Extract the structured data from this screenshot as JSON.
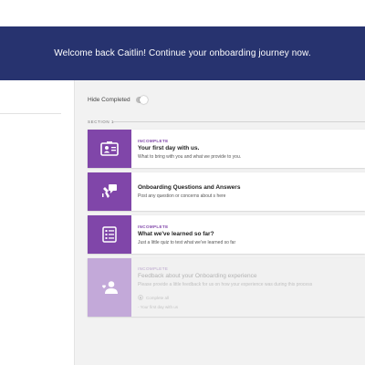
{
  "banner": {
    "text": "Welcome back Caitlin! Continue your onboarding journey now."
  },
  "controls": {
    "hide_completed_label": "Hide Completed"
  },
  "section": {
    "label": "SECTION 1"
  },
  "cards": [
    {
      "status": "INCOMPLETE",
      "title": "Your first day with us.",
      "description": "What to bring with you and what we provide to you.",
      "icon": "id-card-icon"
    },
    {
      "status": "",
      "title": "Onboarding Questions and Answers",
      "description": "Post any question or concerns about s here",
      "icon": "qa-icon"
    },
    {
      "status": "INCOMPLETE",
      "title": "What we've learned so far?",
      "description": "Just a little quiz to test what we've learned so far",
      "icon": "quiz-list-icon"
    },
    {
      "status": "INCOMPLETE",
      "title": "Feedback about your Onboarding experience",
      "description": "Please provide a little feedback for us on how your experience was during this process",
      "icon": "feedback-person-icon",
      "requirement_label": "Complete all",
      "requirement_item": "- Your first day with us"
    }
  ],
  "colors": {
    "banner_bg": "#27336f",
    "accent_purple": "#8046a9",
    "locked_purple": "#c3a9d9"
  }
}
